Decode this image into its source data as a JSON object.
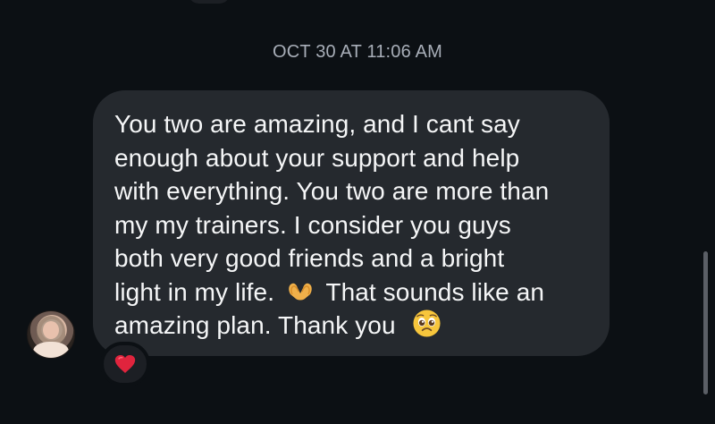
{
  "conversation": {
    "timestamp": "OCT 30 AT 11:06 AM",
    "message": {
      "lines": [
        "You two are amazing, and I cant say",
        "enough about your support and help",
        "with everything. You two are more than",
        "my my trainers. I consider you guys",
        "both very good friends and a bright",
        "light in my life.",
        "That sounds like an",
        "amazing plan. Thank you"
      ],
      "emojis": [
        "heart-hands-emoji",
        "pleading-face-emoji"
      ]
    },
    "reaction": {
      "emoji": "red-heart-icon",
      "color": "#e0243d"
    },
    "sender_avatar": "avatar"
  },
  "colors": {
    "background": "#0c1014",
    "bubble": "#25292e",
    "text": "#f5f6f7",
    "timestamp": "#a8aeb8"
  }
}
